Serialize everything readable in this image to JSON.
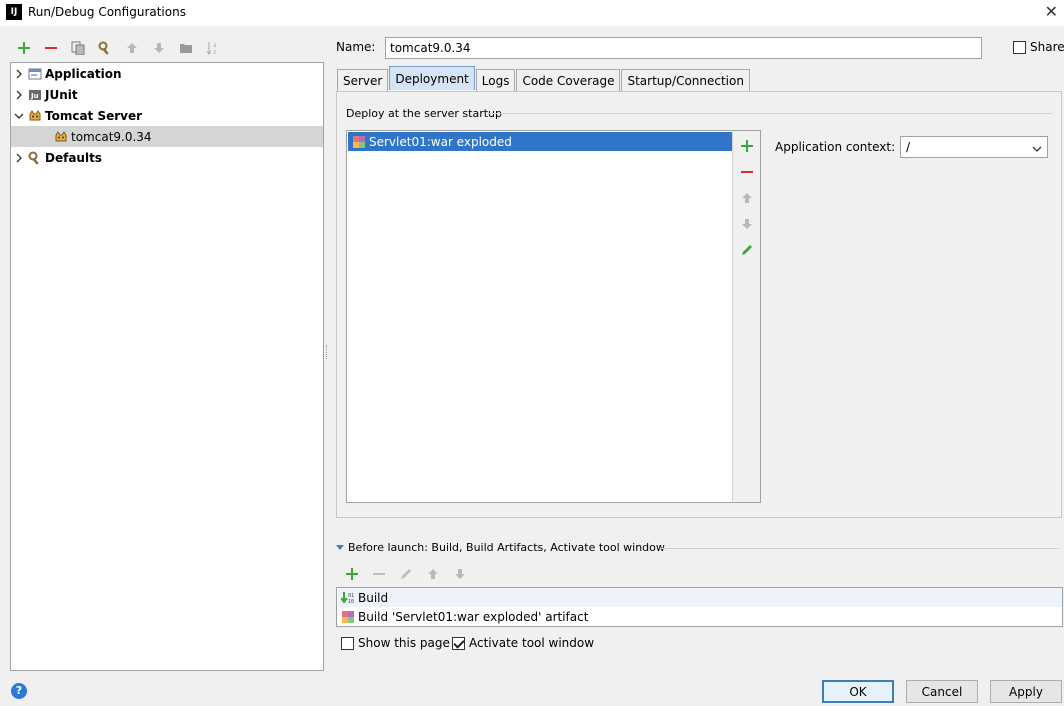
{
  "window": {
    "title": "Run/Debug Configurations",
    "app_badge": "IJ",
    "close_glyph": "✕"
  },
  "left_toolbar": {
    "icons": [
      "add-icon",
      "remove-icon",
      "copy-icon",
      "edit-defaults-icon",
      "move-up-icon",
      "move-down-icon",
      "folder-icon",
      "sort-icon"
    ]
  },
  "tree": {
    "items": [
      {
        "label": "Application",
        "icon": "application-icon",
        "expanded": false,
        "bold": true
      },
      {
        "label": "JUnit",
        "icon": "junit-icon",
        "expanded": false,
        "bold": true
      },
      {
        "label": "Tomcat Server",
        "icon": "tomcat-icon",
        "expanded": true,
        "bold": true
      },
      {
        "label": "tomcat9.0.34",
        "icon": "tomcat-icon",
        "selected": true,
        "bold": false
      },
      {
        "label": "Defaults",
        "icon": "wrench-icon",
        "expanded": false,
        "bold": true
      }
    ]
  },
  "config": {
    "name_label": "Name:",
    "name_value": "tomcat9.0.34",
    "share_label": "Share",
    "share_checked": false
  },
  "tabs": [
    {
      "label": "Server",
      "active": false
    },
    {
      "label": "Deployment",
      "active": true
    },
    {
      "label": "Logs",
      "active": false
    },
    {
      "label": "Code Coverage",
      "active": false
    },
    {
      "label": "Startup/Connection",
      "active": false
    }
  ],
  "deployment": {
    "group_title": "Deploy at the server startup",
    "items": [
      {
        "label": "Servlet01:war exploded",
        "icon": "artifact-icon",
        "selected": true
      }
    ],
    "side_buttons": [
      "add-icon",
      "remove-icon",
      "move-up-icon",
      "move-down-icon",
      "edit-icon"
    ],
    "context_label": "Application context:",
    "context_value": "/"
  },
  "before_launch": {
    "title": "Before launch: Build, Build Artifacts, Activate tool window",
    "toolbar": [
      "add-icon",
      "remove-icon",
      "edit-icon",
      "move-up-icon",
      "move-down-icon"
    ],
    "tasks": [
      {
        "label": "Build",
        "icon": "build-icon"
      },
      {
        "label": "Build 'Servlet01:war exploded' artifact",
        "icon": "artifact-icon"
      }
    ],
    "show_page_label": "Show this page",
    "show_page_checked": false,
    "activate_label": "Activate tool window",
    "activate_checked": true
  },
  "buttons": {
    "help": "?",
    "ok": "OK",
    "cancel": "Cancel",
    "apply": "Apply"
  },
  "colors": {
    "selection": "#2f76c8",
    "tree_selection": "#d5d5d5",
    "add_green": "#3aa33a",
    "remove_red": "#d03030"
  }
}
